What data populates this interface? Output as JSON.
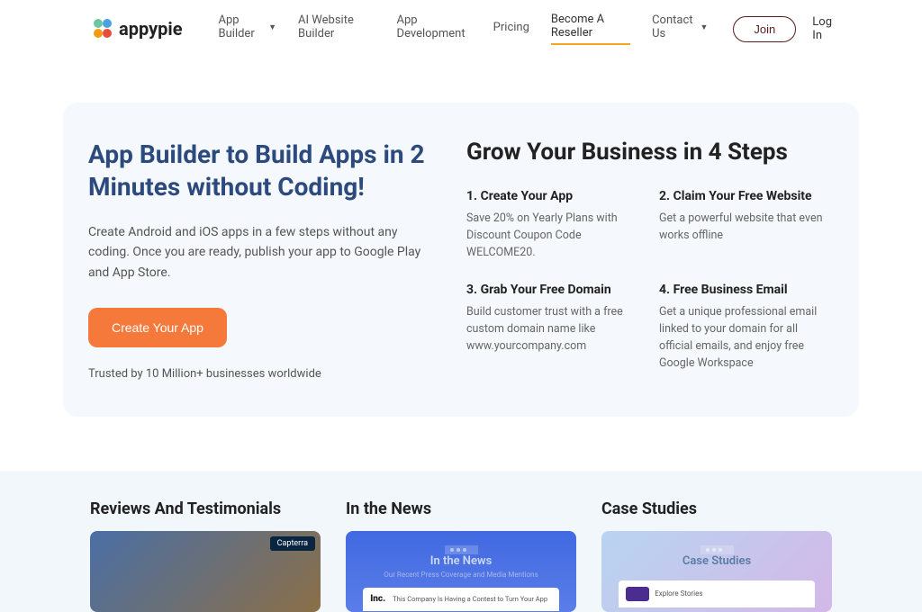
{
  "brand": "appypie",
  "nav": {
    "items": [
      {
        "label": "App Builder",
        "dropdown": true
      },
      {
        "label": "AI Website Builder",
        "dropdown": false
      },
      {
        "label": "App Development",
        "dropdown": false
      },
      {
        "label": "Pricing",
        "dropdown": false
      },
      {
        "label": "Become A Reseller",
        "dropdown": false,
        "active": true
      },
      {
        "label": "Contact Us",
        "dropdown": true
      }
    ]
  },
  "auth": {
    "join": "Join",
    "login": "Log In"
  },
  "hero": {
    "title": "App Builder to Build Apps in 2 Minutes without Coding!",
    "desc": "Create Android and iOS apps in a few steps without any coding. Once you are ready, publish your app to Google Play and App Store.",
    "cta": "Create Your App",
    "trusted": "Trusted by 10 Million+ businesses worldwide"
  },
  "grow": {
    "title": "Grow Your Business in 4 Steps",
    "steps": [
      {
        "title": "1. Create Your App",
        "desc": "Save 20% on Yearly Plans with Discount Coupon Code WELCOME20."
      },
      {
        "title": "2. Claim Your Free Website",
        "desc": "Get a powerful website that even works offline"
      },
      {
        "title": "3. Grab Your Free Domain",
        "desc": "Build customer trust with a free custom domain name like www.yourcompany.com"
      },
      {
        "title": "4. Free Business Email",
        "desc": "Get a unique professional email linked to your domain for all official emails, and enjoy free Google Workspace"
      }
    ]
  },
  "section2": {
    "cards": [
      {
        "title": "Reviews And Testimonials",
        "badge": "Capterra"
      },
      {
        "title": "In the News",
        "inner_title": "In the News",
        "inner_sub": "Our Recent Press Coverage and Media Mentions",
        "inc": "Inc.",
        "news": "This Company Is Having a Contest to Turn Your App"
      },
      {
        "title": "Case Studies",
        "inner_title": "Case Studies",
        "case_text": "Explore Stories"
      }
    ]
  }
}
